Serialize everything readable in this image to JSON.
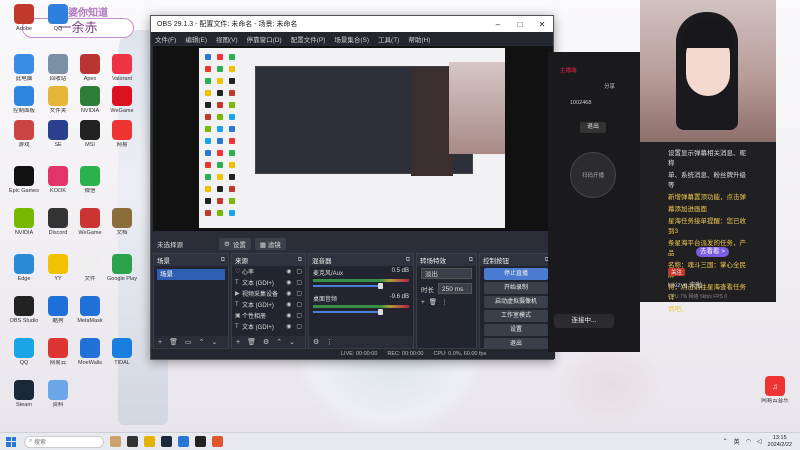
{
  "name_tag": {
    "small": "老婆你知道",
    "big": "一余赤"
  },
  "desktop_icons": [
    {
      "label": "Adobe",
      "color": "#c0392b"
    },
    {
      "label": "QQ",
      "color": "#2f7fdc"
    },
    {
      "label": "此电脑",
      "color": "#3a8ee6"
    },
    {
      "label": "回收站",
      "color": "#7b8fa6"
    },
    {
      "label": "Apex",
      "color": "#b33"
    },
    {
      "label": "Valorant",
      "color": "#e34"
    },
    {
      "label": "控制面板",
      "color": "#2e86de"
    },
    {
      "label": "文件夹",
      "color": "#e5b53a"
    },
    {
      "label": "NVIDIA",
      "color": "#2f7d3a"
    },
    {
      "label": "WeGame",
      "color": "#d12"
    },
    {
      "label": "游戏",
      "color": "#c44"
    },
    {
      "label": "SE",
      "color": "#2b3f8f"
    },
    {
      "label": "MSI",
      "color": "#222"
    },
    {
      "label": "网易",
      "color": "#e33"
    },
    {
      "label": "Epic Games",
      "color": "#111"
    },
    {
      "label": "KOOK",
      "color": "#e2336b"
    },
    {
      "label": "微信",
      "color": "#2bb24c"
    },
    {
      "label": "NVIDIA",
      "color": "#76b900"
    },
    {
      "label": "Discord",
      "color": "#333"
    },
    {
      "label": "WeGame",
      "color": "#c33"
    },
    {
      "label": "文档",
      "color": "#8a6d3b"
    },
    {
      "label": "Edge",
      "color": "#2a8bd8"
    },
    {
      "label": "YY",
      "color": "#f2c200"
    },
    {
      "label": "文件",
      "color": "#eee"
    },
    {
      "label": "Google Play",
      "color": "#2ca24c"
    },
    {
      "label": "OBS Studio",
      "color": "#222"
    },
    {
      "label": "酷狗",
      "color": "#1e6fd9"
    },
    {
      "label": "MetaMask",
      "color": "#2271d8"
    },
    {
      "label": "QQ",
      "color": "#1aa4e8"
    },
    {
      "label": "网易云",
      "color": "#d33"
    },
    {
      "label": "MoeWalls",
      "color": "#2271d8"
    },
    {
      "label": "TIDAL",
      "color": "#1a7ee0"
    },
    {
      "label": "Steam",
      "color": "#1b2838"
    },
    {
      "label": "资料",
      "color": "#6aa6e8"
    }
  ],
  "right_icon": {
    "label": "网易云音乐",
    "color": "#e33"
  },
  "obs": {
    "title": "OBS 29.1.3 - 配置文件: 未命名 - 场景: 未命名",
    "menu": [
      "文件(F)",
      "编辑(E)",
      "视图(V)",
      "停靠窗口(D)",
      "配置文件(P)",
      "场景集合(S)",
      "工具(T)",
      "帮助(H)"
    ],
    "scene_bar": {
      "label": "未选择源",
      "settings": "设置",
      "filters": "滤镜"
    },
    "docks": {
      "scenes": {
        "title": "场景",
        "items": [
          "场景"
        ]
      },
      "sources": {
        "title": "来源",
        "items": [
          "心率",
          "文本 (GDI+)",
          "视频采集设备",
          "文本 (GDI+)",
          "个性相册",
          "文本 (GDI+)"
        ]
      },
      "mixer": {
        "title": "混音器",
        "rows": [
          {
            "name": "麦克风/Aux",
            "db": "0.5 dB"
          },
          {
            "name": "桌面音频",
            "db": "-9.6 dB"
          }
        ]
      },
      "transitions": {
        "title": "转场特效",
        "type": "淡出",
        "duration_label": "时长",
        "duration": "250 ms"
      },
      "controls": {
        "title": "控制按钮",
        "buttons": [
          "停止直播",
          "开始录制",
          "启动虚拟摄像机",
          "工作室模式",
          "设置",
          "退出"
        ]
      }
    },
    "status": {
      "live": "LIVE: 00:00:00",
      "rec": "REC: 00:00:00",
      "cpu": "CPU: 0.0%, 60.00 fps"
    }
  },
  "live_app": {
    "tab1": "主播端",
    "tab2": "分享",
    "count": "1002468",
    "btn": "退出",
    "circle": "扫码开播",
    "connect": "连接中..."
  },
  "chat": {
    "lines": [
      "设置显示弹幕相关消息、昵称",
      "单、系统消息、粉丝牌升级等"
    ],
    "yellow_lines": [
      "新增弹幕置顶功能，点击弹",
      "幕添加进画面",
      "星海任务接单提醒：您已收到3",
      "条星海平台派发的任务，产品",
      "名称：魂斗三国：掌心全民麻",
      "将，点击前往星海查看任务详",
      "情吧。"
    ],
    "greet": "去看看 >",
    "badge": "关注",
    "user": "kikizyq  来啦",
    "cpu": "CPU 7%   网络 5kb/s  FPS 0"
  },
  "taskbar": {
    "search": "搜索",
    "lang": "英",
    "time": "13:15",
    "date": "2024/2/22"
  }
}
